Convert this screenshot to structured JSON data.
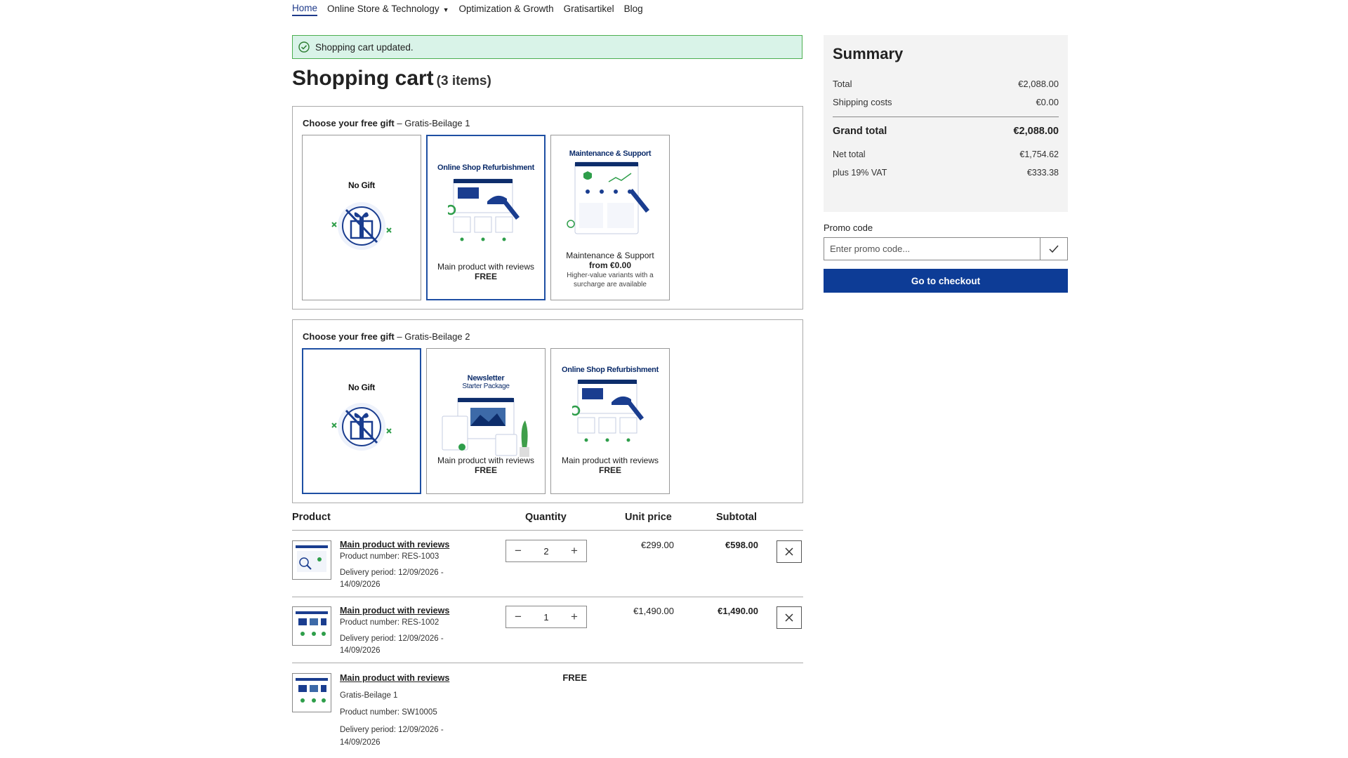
{
  "nav": {
    "items": [
      {
        "label": "Home"
      },
      {
        "label": "Online Store & Technology"
      },
      {
        "label": "Optimization & Growth"
      },
      {
        "label": "Gratisartikel"
      },
      {
        "label": "Blog"
      }
    ]
  },
  "alert": {
    "message": "Shopping cart updated."
  },
  "cart": {
    "title": "Shopping cart",
    "count": "(3 items)"
  },
  "gifts": [
    {
      "heading": "Choose your free gift",
      "subheading": "– Gratis-Beilage 1",
      "cards": [
        {
          "img_title": "No Gift",
          "label": "",
          "price": "",
          "note": ""
        },
        {
          "img_title": "Online Shop Refurbishment",
          "label": "Main product with reviews",
          "price": "FREE",
          "note": ""
        },
        {
          "img_title": "Maintenance & Support",
          "label": "Maintenance & Support",
          "price": "from €0.00",
          "note": "Higher-value variants with a surcharge are available"
        }
      ]
    },
    {
      "heading": "Choose your free gift",
      "subheading": "– Gratis-Beilage 2",
      "cards": [
        {
          "img_title": "No Gift",
          "label": "",
          "price": "",
          "note": ""
        },
        {
          "img_title": "Newsletter",
          "img_subtitle": "Starter Package",
          "label": "Main product with reviews",
          "price": "FREE",
          "note": ""
        },
        {
          "img_title": "Online Shop Refurbishment",
          "label": "Main product with reviews",
          "price": "FREE",
          "note": ""
        }
      ]
    }
  ],
  "table": {
    "headers": {
      "product": "Product",
      "quantity": "Quantity",
      "unit_price": "Unit price",
      "subtotal": "Subtotal"
    },
    "rows": [
      {
        "name": "Main product with reviews",
        "extra": "",
        "number": "Product number: RES-1003",
        "delivery": "Delivery period: 12/09/2026 -",
        "delivery2": "14/09/2026",
        "qty": "2",
        "unit": "€299.00",
        "subtotal": "€598.00",
        "free": ""
      },
      {
        "name": "Main product with reviews",
        "extra": "",
        "number": "Product number: RES-1002",
        "delivery": "Delivery period: 12/09/2026 -",
        "delivery2": "14/09/2026",
        "qty": "1",
        "unit": "€1,490.00",
        "subtotal": "€1,490.00",
        "free": ""
      },
      {
        "name": "Main product with reviews",
        "extra": "Gratis-Beilage 1",
        "number": "Product number: SW10005",
        "delivery": "Delivery period: 12/09/2026 -",
        "delivery2": "14/09/2026",
        "qty": "",
        "unit": "",
        "subtotal": "",
        "free": "FREE"
      }
    ]
  },
  "summary": {
    "title": "Summary",
    "total_label": "Total",
    "total": "€2,088.00",
    "shipping_label": "Shipping costs",
    "shipping": "€0.00",
    "grand_label": "Grand total",
    "grand": "€2,088.00",
    "net_label": "Net total",
    "net": "€1,754.62",
    "vat_label": "plus 19% VAT",
    "vat": "€333.38"
  },
  "promo": {
    "label": "Promo code",
    "placeholder": "Enter promo code..."
  },
  "checkout": {
    "label": "Go to checkout"
  },
  "colors": {
    "primary": "#0d3c96",
    "alert_bg": "#d9f3e8",
    "alert_border": "#4caf50"
  }
}
